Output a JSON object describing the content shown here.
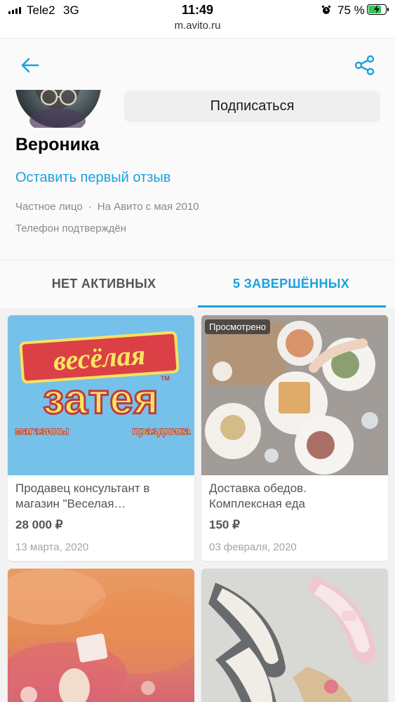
{
  "status_bar": {
    "carrier": "Tele2",
    "network": "3G",
    "time": "11:49",
    "battery_percent": "75 %",
    "battery_level": 0.75,
    "icons": [
      "signal-icon",
      "alarm-icon",
      "battery-icon",
      "charging-icon"
    ]
  },
  "browser": {
    "url": "m.avito.ru"
  },
  "header": {
    "icons": [
      "back-arrow-icon",
      "share-icon"
    ]
  },
  "profile": {
    "subscribe_label": "Подписаться",
    "name": "Вероника",
    "review_link": "Оставить первый отзыв",
    "seller_type": "Частное лицо",
    "separator": "·",
    "member_since": "На Авито с мая 2010",
    "phone_status": "Телефон подтверждён"
  },
  "tabs": [
    {
      "label": "НЕТ АКТИВНЫХ",
      "active": false
    },
    {
      "label": "5 ЗАВЕРШЁННЫХ",
      "active": true
    }
  ],
  "listings": [
    {
      "title": "Продавец консультант в магазин \"Веселая…",
      "price": "28 000 ₽",
      "date": "13 марта, 2020",
      "badge": "",
      "image_text": {
        "line1": "весёлая",
        "line2": "затея",
        "line3_left": "магазины",
        "line3_right": "праздника",
        "tm": "TM"
      }
    },
    {
      "title": "Доставка обедов. Комплексная еда",
      "price": "150 ₽",
      "date": "03 февраля, 2020",
      "badge": "Просмотрено"
    },
    {
      "title": "",
      "price": "",
      "date": "",
      "badge": ""
    },
    {
      "title": "",
      "price": "",
      "date": "",
      "badge": ""
    }
  ],
  "colors": {
    "accent": "#1ba1e0",
    "charging_green": "#35c759"
  }
}
